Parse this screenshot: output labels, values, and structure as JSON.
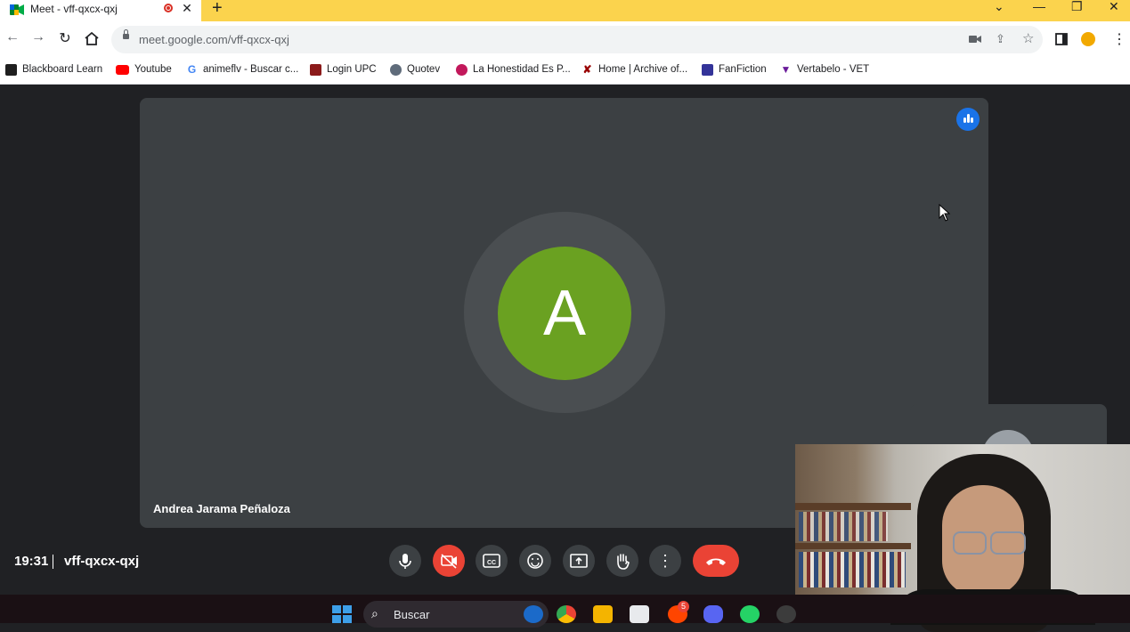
{
  "browser": {
    "tab": {
      "title": "Meet - vff-qxcx-qxj"
    },
    "address": {
      "url": "meet.google.com/vff-qxcx-qxj"
    }
  },
  "bookmarks": [
    {
      "label": "Blackboard Learn",
      "icon": "blackboard-icon",
      "color": "#1f1f1f"
    },
    {
      "label": "Youtube",
      "icon": "youtube-icon",
      "color": "#ff0000"
    },
    {
      "label": "animeflv - Buscar c...",
      "icon": "google-icon",
      "color": "#4285f4"
    },
    {
      "label": "Login UPC",
      "icon": "upc-icon",
      "color": "#8b1a1a"
    },
    {
      "label": "Quotev",
      "icon": "quotev-icon",
      "color": "#5f6b7a"
    },
    {
      "label": "La Honestidad Es P...",
      "icon": "honestidad-icon",
      "color": "#c2185b"
    },
    {
      "label": "Home | Archive of...",
      "icon": "ao3-icon",
      "color": "#990000"
    },
    {
      "label": "FanFiction",
      "icon": "fanfiction-icon",
      "color": "#333399"
    },
    {
      "label": "Vertabelo - VET",
      "icon": "vertabelo-icon",
      "color": "#6a1b9a"
    }
  ],
  "meet": {
    "participant_initial": "A",
    "participant_name": "Andrea Jarama Peñaloza",
    "time": "19:31",
    "meeting_code": "vff-qxcx-qxj",
    "colors": {
      "avatar": "#6aa121",
      "end_call": "#ea4335",
      "speaking": "#1a73e8"
    }
  },
  "taskbar": {
    "search_label": "Buscar",
    "reddit_badge": "5"
  }
}
